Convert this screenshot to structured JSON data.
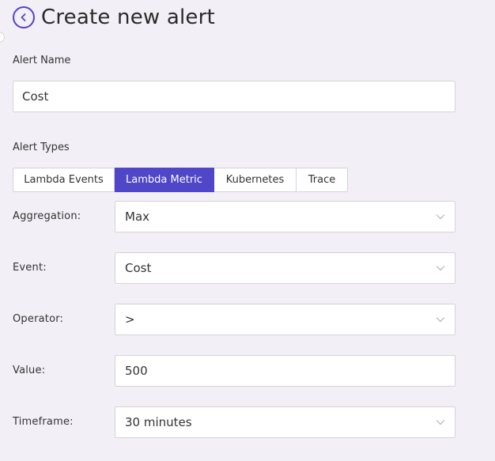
{
  "header": {
    "title": "Create new alert",
    "back_icon": "chevron-left-icon",
    "accent_color": "#4f46c8"
  },
  "alert_name": {
    "label": "Alert Name",
    "value": "Cost"
  },
  "alert_types": {
    "label": "Alert Types",
    "tabs": [
      {
        "label": "Lambda Events",
        "active": false
      },
      {
        "label": "Lambda Metric",
        "active": true
      },
      {
        "label": "Kubernetes",
        "active": false
      },
      {
        "label": "Trace",
        "active": false
      }
    ]
  },
  "form": {
    "aggregation": {
      "label": "Aggregation:",
      "value": "Max"
    },
    "event": {
      "label": "Event:",
      "value": "Cost"
    },
    "operator": {
      "label": "Operator:",
      "value": ">"
    },
    "value": {
      "label": "Value:",
      "value": "500"
    },
    "timeframe": {
      "label": "Timeframe:",
      "value": "30 minutes"
    }
  }
}
